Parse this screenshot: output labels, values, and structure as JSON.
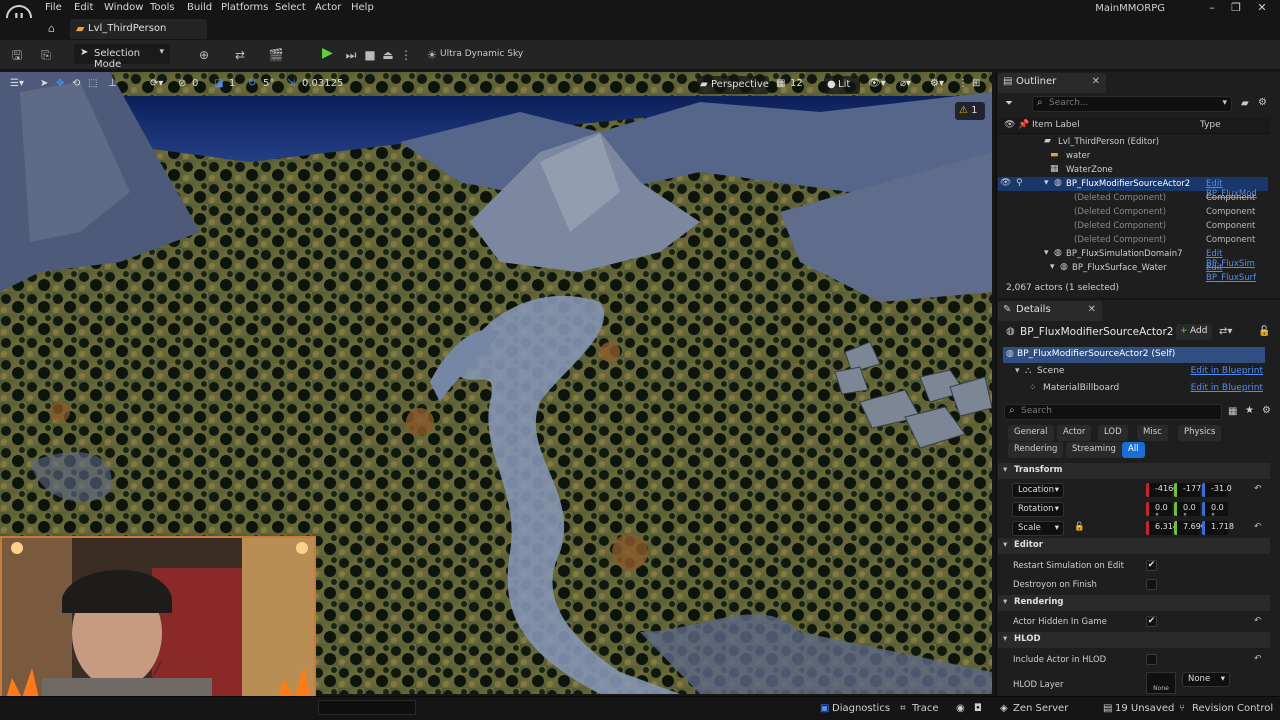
{
  "menubar": {
    "items": [
      "File",
      "Edit",
      "Window",
      "Tools",
      "Build",
      "Platforms",
      "Select",
      "Actor",
      "Help"
    ],
    "project_name": "MainMMORPG"
  },
  "tab": {
    "level_name": "Lvl_ThirdPerson"
  },
  "toolbar": {
    "selection_mode": "Selection Mode",
    "sky_label": "Ultra Dynamic Sky"
  },
  "viewport_toolbar": {
    "rotation_snap": "0",
    "scale_snap_a": "1",
    "angle_snap": "5°",
    "scale_snap_value": "0.03125",
    "perspective": "Perspective",
    "fov_value": "12",
    "lit": "Lit",
    "warning_count": "1"
  },
  "outliner": {
    "tab_label": "Outliner",
    "search_placeholder": "Search...",
    "col_item_label": "Item Label",
    "col_type": "Type",
    "rows": [
      {
        "name": "Lvl_ThirdPerson (Editor)",
        "type": ""
      },
      {
        "name": "water",
        "type": ""
      },
      {
        "name": "WaterZone",
        "type": ""
      },
      {
        "name": "BP_FluxModifierSourceActor2",
        "type": "Edit BP_FluxMod"
      },
      {
        "name": "(Deleted Component)",
        "type": "Component"
      },
      {
        "name": "(Deleted Component)",
        "type": "Component"
      },
      {
        "name": "(Deleted Component)",
        "type": "Component"
      },
      {
        "name": "(Deleted Component)",
        "type": "Component"
      },
      {
        "name": "BP_FluxSimulationDomain7",
        "type": "Edit BP_FluxSim"
      },
      {
        "name": "BP_FluxSurface_Water",
        "type": "Edit BP_FluxSurf"
      }
    ],
    "actor_count": "2,067 actors (1 selected)"
  },
  "details": {
    "tab_label": "Details",
    "actor_name": "BP_FluxModifierSourceActor2",
    "add_label": "Add",
    "components": [
      {
        "name": "BP_FluxModifierSourceActor2 (Self)",
        "link": ""
      },
      {
        "name": "Scene",
        "link": "Edit in Blueprint"
      },
      {
        "name": "MaterialBillboard",
        "link": "Edit in Blueprint"
      }
    ],
    "search_placeholder": "Search",
    "filters_row1": [
      "General",
      "Actor",
      "LOD",
      "Misc",
      "Physics"
    ],
    "filters_row2": [
      "Rendering",
      "Streaming",
      "All"
    ],
    "transform_header": "Transform",
    "location_label": "Location",
    "location": [
      "-416€",
      "-177!",
      "-31.0"
    ],
    "rotation_label": "Rotation",
    "rotation": [
      "0.0 °",
      "0.0 °",
      "0.0 °"
    ],
    "scale_label": "Scale",
    "scale": [
      "6.314",
      "7.69€",
      "1.718"
    ],
    "editor_header": "Editor",
    "restart_sim": "Restart Simulation on Edit",
    "restart_sim_checked": true,
    "destroy_finish": "Destroyon on Finish",
    "destroy_finish_checked": false,
    "rendering_header": "Rendering",
    "actor_hidden": "Actor Hidden In Game",
    "actor_hidden_checked": true,
    "hlod_header": "HLOD",
    "include_hlod": "Include Actor in HLOD",
    "include_hlod_checked": false,
    "hlod_layer": "HLOD Layer",
    "hlod_layer_value": "None",
    "hlod_layer_thumb": "None"
  },
  "statusbar": {
    "diagnostics": "Diagnostics",
    "trace": "Trace",
    "zen_server": "Zen Server",
    "unsaved": "19 Unsaved",
    "revision_control": "Revision Control"
  },
  "colors": {
    "accent_blue": "#1a6fd6",
    "play_green": "#5fcf3a",
    "link_blue": "#4f8ef7",
    "selection": "#18376b"
  }
}
